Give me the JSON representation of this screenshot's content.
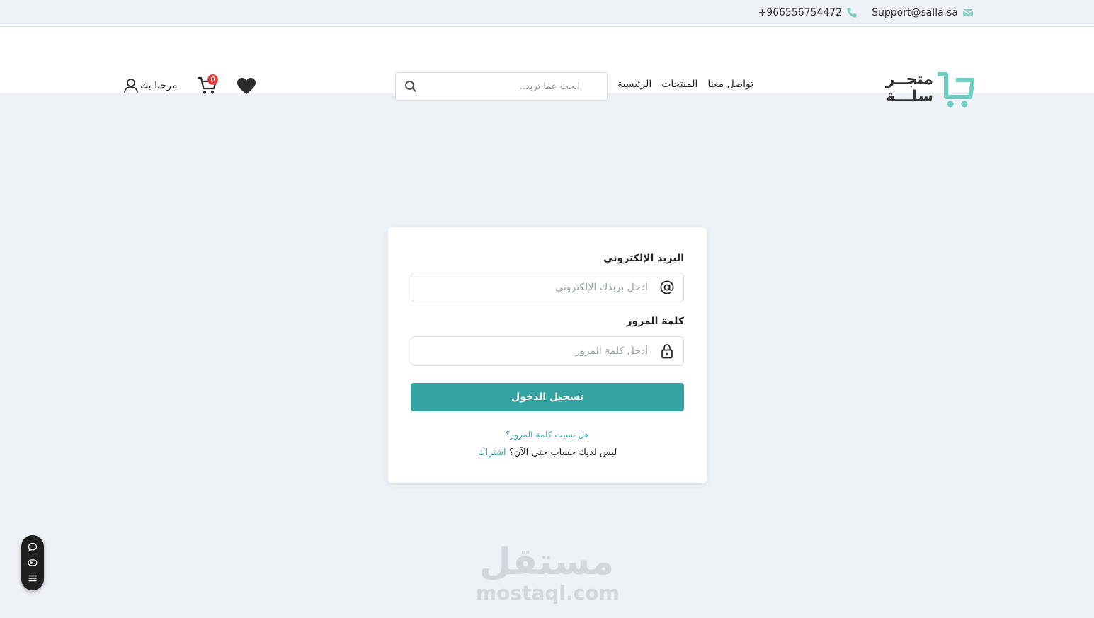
{
  "topbar": {
    "email": "Support@salla.sa",
    "phone": "+966556754472"
  },
  "header": {
    "logo_line1": "متجــر",
    "logo_line2": "سلـــة",
    "nav": [
      "الرئيسية",
      "المنتجات",
      "تواصل معنا"
    ],
    "search_placeholder": "ابحث عما تريد..",
    "cart_count": "0",
    "account_label": "مرحبا بك"
  },
  "login": {
    "email_label": "البريد الإلكتروني",
    "email_placeholder": "أدخل بريدك الإلكتروني",
    "password_label": "كلمة المرور",
    "password_placeholder": "أدخل كلمة المرور",
    "submit_label": "تسجيل الدخول",
    "forgot_label": "هل نسيت كلمة المرور؟",
    "no_account_text": "ليس لديك حساب حتى الآن؟",
    "signup_label": "اشتراك"
  },
  "watermark": {
    "arabic": "مستقل",
    "english": "mostaql.com"
  },
  "colors": {
    "accent": "#36a3a3",
    "badge": "#e53e3e",
    "background": "#eef1f5"
  },
  "icons": [
    "mail-icon",
    "phone-icon",
    "search-icon",
    "heart-icon",
    "cart-icon",
    "user-icon",
    "at-icon",
    "lock-icon",
    "chat-icon",
    "eye-icon",
    "menu-icon"
  ]
}
